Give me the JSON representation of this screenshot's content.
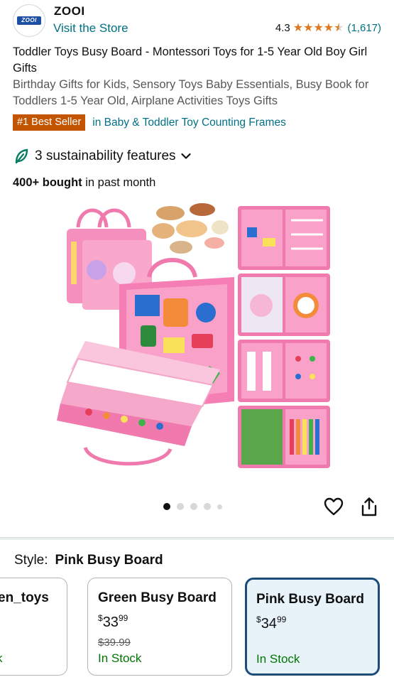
{
  "header": {
    "logo_text": "ZOOI",
    "brand": "ZOOI",
    "visit_store": "Visit the Store",
    "rating": "4.3",
    "rating_value": 4.3,
    "rating_count": "(1,617)"
  },
  "product": {
    "title": "Toddler Toys Busy Board - Montessori Toys for 1-5 Year Old Boy Girl Gifts",
    "subtitle": "Birthday Gifts for Kids, Sensory Toys Baby Essentials, Busy Book for Toddlers 1-5 Year Old, Airplane Activities Toys Gifts",
    "best_seller_badge": "#1 Best Seller",
    "best_seller_category": "in Baby & Toddler Toy Counting Frames",
    "sustainability": "3 sustainability features",
    "bought_bold": "400+ bought",
    "bought_rest": " in past month",
    "image_count": 5,
    "image_active_index": 0
  },
  "style": {
    "label": "Style:",
    "selected": "Pink Busy Board",
    "options": [
      {
        "name": "en_toys",
        "stock_partial": "k"
      },
      {
        "name": "Green Busy Board",
        "price_currency": "$",
        "price_whole": "33",
        "price_cents": "99",
        "list_price": "$39.99",
        "stock": "In Stock"
      },
      {
        "name": "Pink Busy Board",
        "price_currency": "$",
        "price_whole": "34",
        "price_cents": "99",
        "stock": "In Stock"
      }
    ]
  },
  "colors": {
    "link": "#007185",
    "best_seller": "#c45500",
    "star": "#de7921",
    "in_stock": "#007600",
    "selected_border": "#1b4c7a",
    "product_pink": "#f48fb9"
  }
}
